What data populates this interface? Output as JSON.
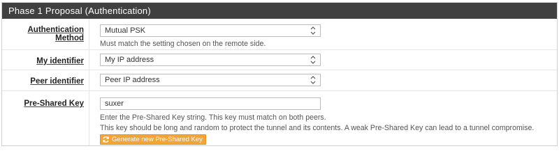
{
  "panel": {
    "title": "Phase 1 Proposal (Authentication)"
  },
  "fields": {
    "auth_method": {
      "label": "Authentication Method",
      "value": "Mutual PSK",
      "help": "Must match the setting chosen on the remote side."
    },
    "my_identifier": {
      "label": "My identifier",
      "value": "My IP address"
    },
    "peer_identifier": {
      "label": "Peer identifier",
      "value": "Peer IP address"
    },
    "psk": {
      "label": "Pre-Shared Key",
      "value": "suxer",
      "help_line1": "Enter the Pre-Shared Key string. This key must match on both peers.",
      "help_line2": "This key should be long and random to protect the tunnel and its contents. A weak Pre-Shared Key can lead to a tunnel compromise.",
      "button_label": "Generate new Pre-Shared Key"
    }
  },
  "colors": {
    "header_bg": "#404040",
    "button_bg": "#f0a535"
  },
  "icons": {
    "dropdown": "chevron-updown-icon",
    "refresh": "refresh-icon"
  }
}
